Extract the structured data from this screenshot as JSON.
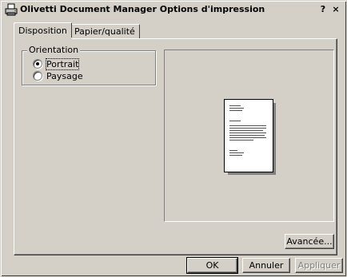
{
  "window": {
    "title": "Olivetti Document Manager Options d'impression",
    "help_label": "?",
    "close_label": "×"
  },
  "tabs": [
    {
      "label": "Disposition",
      "active": true
    },
    {
      "label": "Papier/qualité",
      "active": false
    }
  ],
  "orientation": {
    "legend": "Orientation",
    "options": [
      {
        "label": "Portrait",
        "selected": true
      },
      {
        "label": "Paysage",
        "selected": false
      }
    ]
  },
  "buttons": {
    "advanced": "Avancée...",
    "ok": "OK",
    "cancel": "Annuler",
    "apply": "Appliquer"
  },
  "colors": {
    "face": "#d4d0c8",
    "shadow": "#808080",
    "highlight": "#ffffff",
    "disabled_text": "#808080"
  }
}
